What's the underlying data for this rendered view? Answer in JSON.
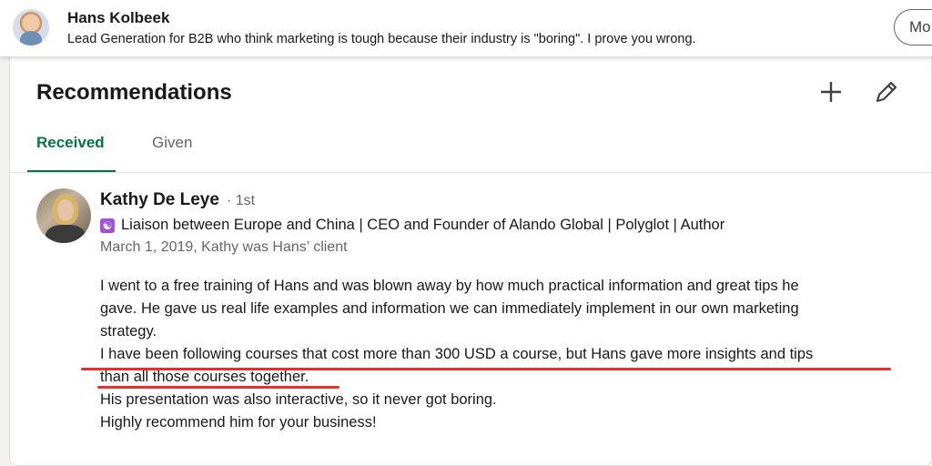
{
  "profile_header": {
    "name": "Hans Kolbeek",
    "headline": "Lead Generation for B2B who think marketing is tough because their industry is \"boring\". I prove you wrong.",
    "more_button_label": "Mo"
  },
  "section": {
    "title": "Recommendations",
    "add_icon": "plus-icon",
    "edit_icon": "pencil-icon",
    "tabs": [
      {
        "label": "Received",
        "selected": true
      },
      {
        "label": "Given",
        "selected": false
      }
    ]
  },
  "recommendation": {
    "name": "Kathy De Leye",
    "degree": "· 1st",
    "badge_icon": "yin-yang-icon",
    "headline": "Liaison between Europe and China | CEO and Founder of Alando Global | Polyglot | Author",
    "meta": "March 1, 2019, Kathy was Hans’ client",
    "lines": [
      "I went to a free training of Hans and was blown away by how much practical information and great tips he",
      "gave. He gave us real life examples and information we can immediately implement in our own marketing",
      "strategy.",
      "I have been following courses that cost more than 300 USD a course, but Hans gave more insights and tips",
      "than all those courses together.",
      "His presentation was also interactive, so it never got boring.",
      "Highly recommend him for your business!"
    ]
  },
  "colors": {
    "accent_green": "#057642",
    "underline_red": "#e0332b"
  }
}
